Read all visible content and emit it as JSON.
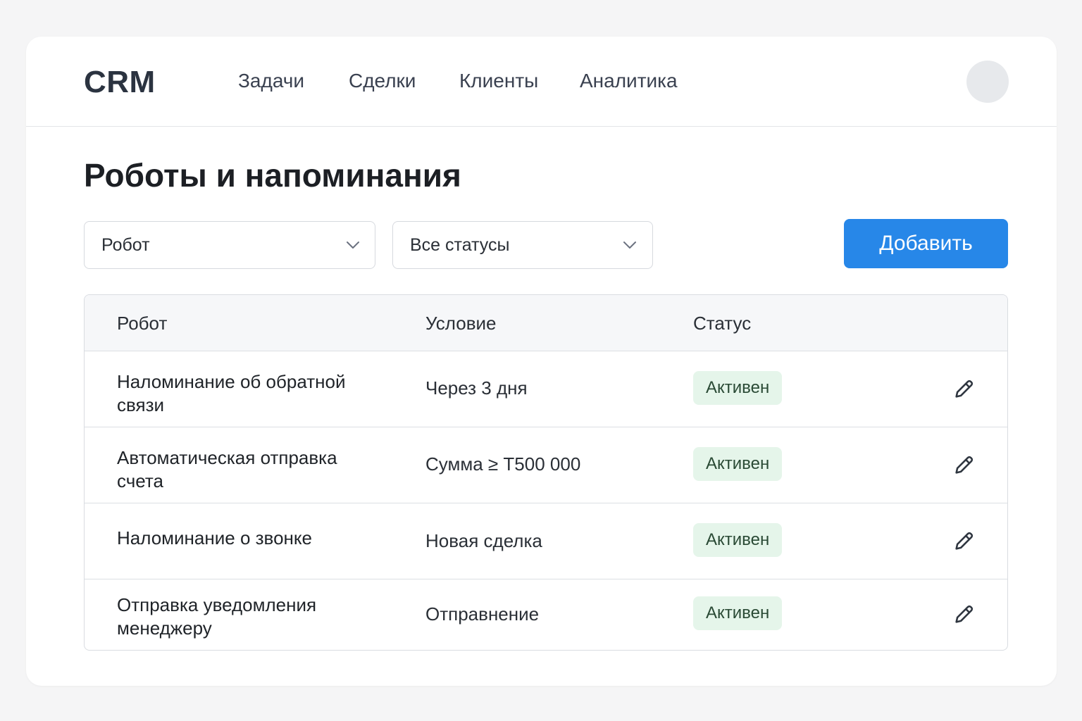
{
  "app": {
    "logo": "CRM"
  },
  "nav": {
    "items": [
      {
        "label": "Задачи"
      },
      {
        "label": "Сделки"
      },
      {
        "label": "Клиенты"
      },
      {
        "label": "Аналитика"
      }
    ]
  },
  "page": {
    "title": "Роботы и напоминания"
  },
  "filters": {
    "robot_select": {
      "value": "Робот",
      "icon": "chevron-down-icon"
    },
    "status_select": {
      "value": "Все статусы",
      "icon": "chevron-down-icon"
    }
  },
  "toolbar": {
    "add_label": "Добавить",
    "accent": "#2787e8"
  },
  "table": {
    "columns": [
      "Робот",
      "Условие",
      "Статус"
    ],
    "rows": [
      {
        "name_line1": "Наломинание об обратной",
        "name_line2": "связи",
        "condition": "Через 3 дня",
        "status": "Активен"
      },
      {
        "name_line1": "Автоматическая отправка",
        "name_line2": "счета",
        "condition": "Сумма ≥ Т500 000",
        "status": "Активен"
      },
      {
        "name_line1": "Наломинание о звонке",
        "name_line2": "",
        "condition": "Новая сделка",
        "status": "Активен"
      },
      {
        "name_line1": "Отправка уведомления",
        "name_line2": "менеджеру",
        "condition": "Отправнение",
        "status": "Активен"
      }
    ],
    "status_color": "#e5f5ea",
    "row_icon": "pencil-icon"
  }
}
